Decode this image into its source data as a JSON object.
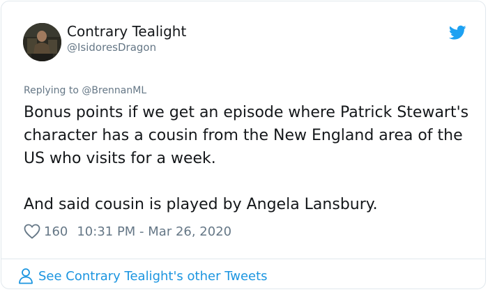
{
  "author": {
    "name": "Contrary Tealight",
    "handle": "@IsidoresDragon",
    "avatar_icon": "profile-photo"
  },
  "reply": {
    "prefix": "Replying to ",
    "mention": "@BrennanML"
  },
  "tweet": {
    "paragraph_1": "Bonus points if we get an episode where Patrick Stewart's character has a cousin from the New England area of the US who visits for a week.",
    "paragraph_2": "And said cousin is played by Angela Lansbury."
  },
  "meta": {
    "like_icon": "heart-icon",
    "like_count": "160",
    "timestamp": "10:31 PM - Mar 26, 2020"
  },
  "footer": {
    "icon": "person-icon",
    "link_text": "See Contrary Tealight's other Tweets"
  },
  "colors": {
    "brand_blue": "#1da1f2",
    "link_blue": "#1b95e0",
    "text_primary": "#14171a",
    "text_secondary": "#657786",
    "border": "#e1e8ed"
  }
}
